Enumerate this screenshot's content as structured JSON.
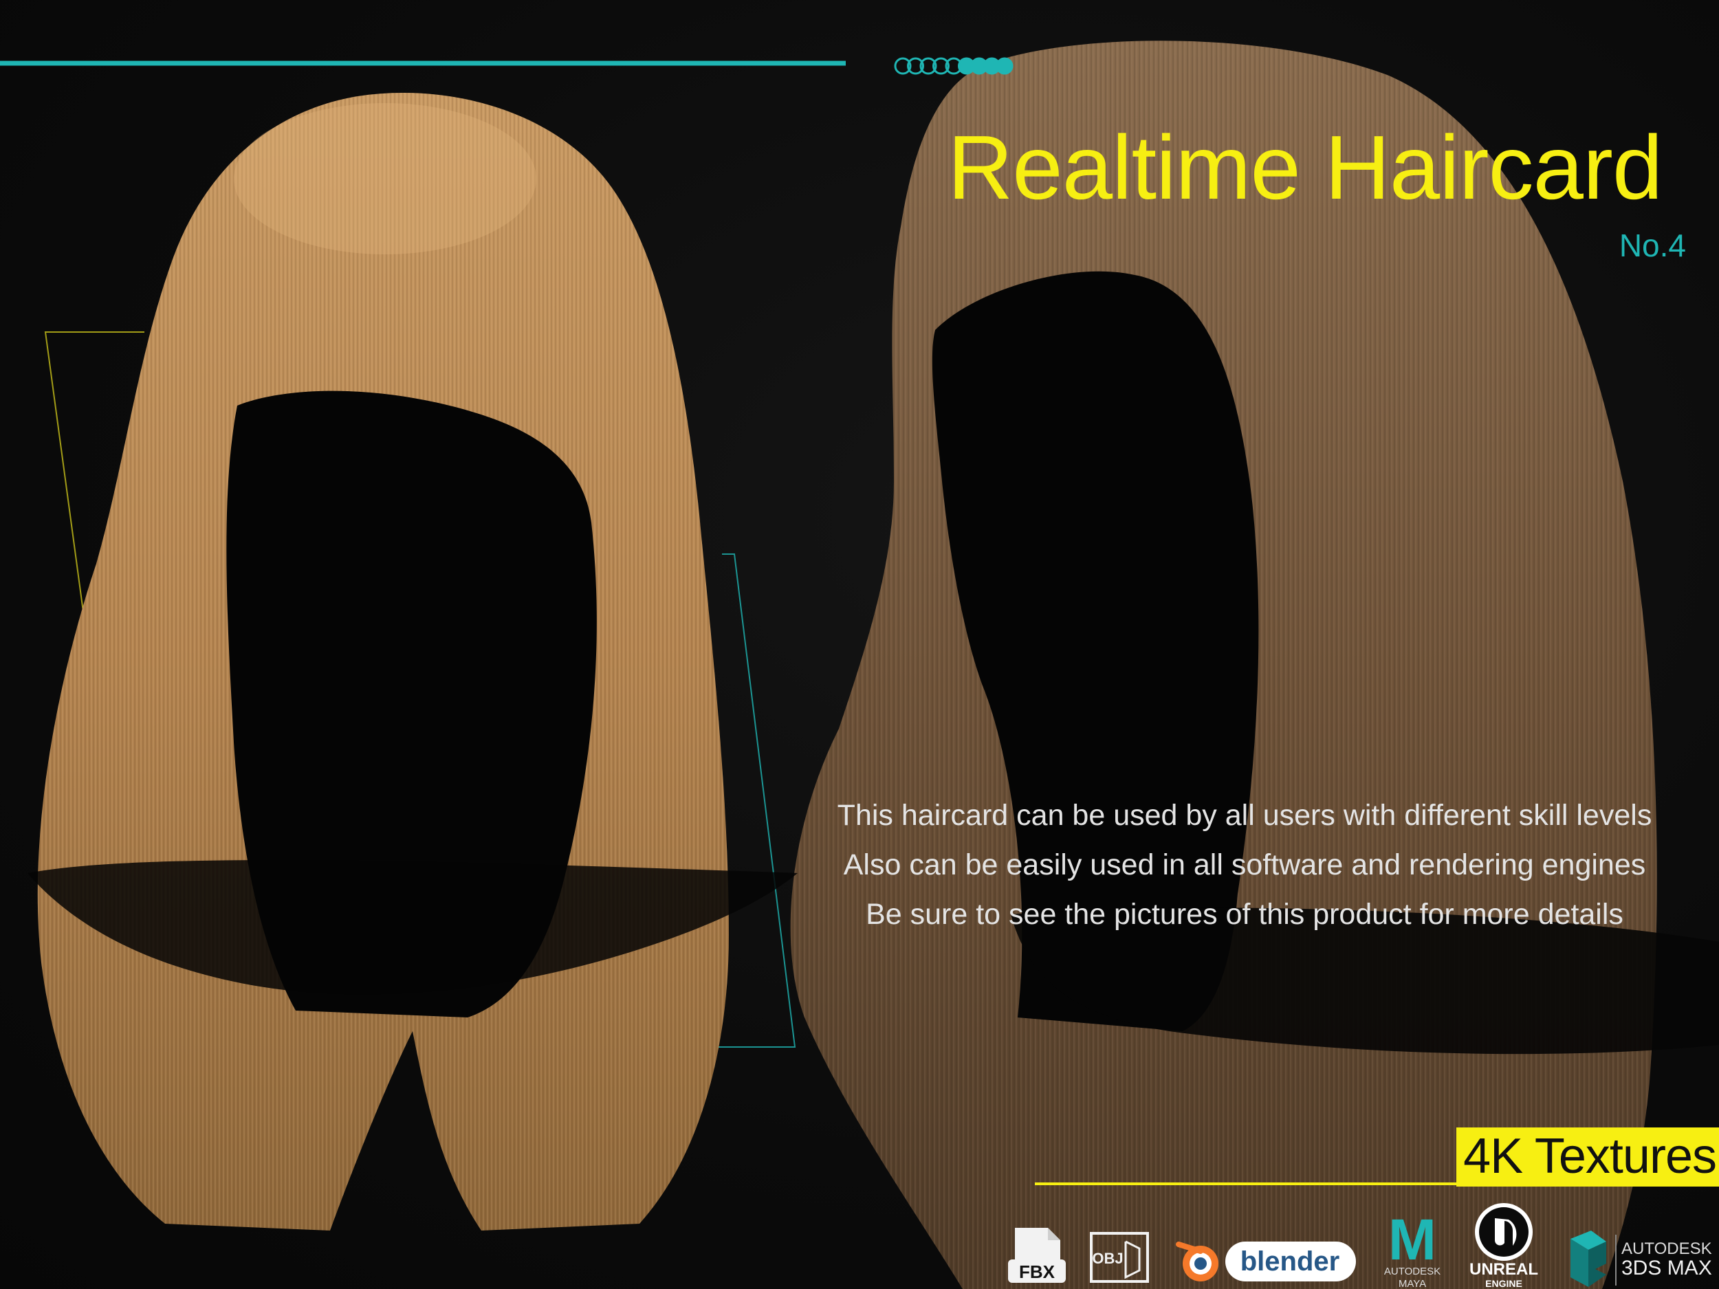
{
  "title": "Realtime Haircard",
  "subtitle": "No.4",
  "description": [
    "This haircard can be used by all users with different skill levels",
    "Also can be easily used in all software and rendering engines",
    "Be sure to see the pictures of this product for more details"
  ],
  "badge": "4K Textures",
  "colors": {
    "accent_yellow": "#f7ef12",
    "accent_teal": "#1fb6b4",
    "background": "#0b0b0b"
  },
  "progress_dots": {
    "total": 9,
    "filled": 4
  },
  "logos": {
    "fbx": "FBX",
    "obj": "OBJ",
    "blender": "blender",
    "maya_top": "AUTODESK",
    "maya_bottom": "MAYA",
    "maya_letter": "M",
    "unreal_top": "UNREAL",
    "unreal_bottom": "ENGINE",
    "max_top": "AUTODESK",
    "max_bottom": "3DS MAX"
  }
}
